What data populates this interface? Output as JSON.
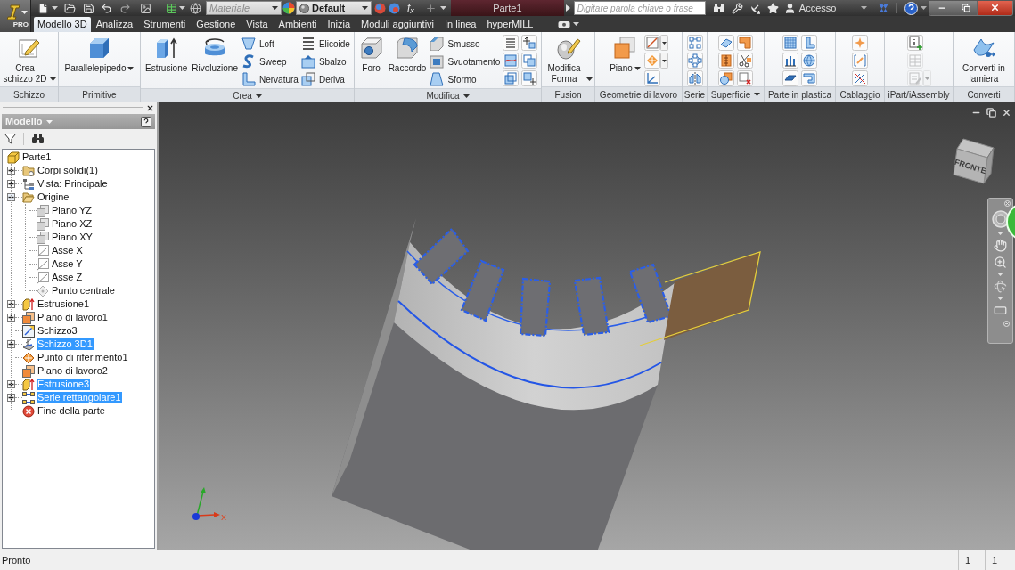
{
  "app_button": {
    "badge": "PRO"
  },
  "title_bar": {
    "material": {
      "value": "Materiale",
      "disabled": true
    },
    "appearance": {
      "value": "Default",
      "disabled": false
    },
    "formula_button": "f$_{x}$",
    "document_title": "Parte1",
    "search": {
      "placeholder": "Digitare parola chiave o frase"
    },
    "sign_in": "Accesso"
  },
  "tabs": [
    {
      "label": "Modello 3D",
      "selected": true
    },
    {
      "label": "Analizza",
      "selected": false
    },
    {
      "label": "Strumenti",
      "selected": false
    },
    {
      "label": "Gestione",
      "selected": false
    },
    {
      "label": "Vista",
      "selected": false
    },
    {
      "label": "Ambienti",
      "selected": false
    },
    {
      "label": "Inizia",
      "selected": false
    },
    {
      "label": "Moduli aggiuntivi",
      "selected": false
    },
    {
      "label": "In linea",
      "selected": false
    },
    {
      "label": "hyperMILL",
      "selected": false
    }
  ],
  "ribbon": [
    {
      "title": "Schizzo",
      "menu": false,
      "tools": [
        {
          "kind": "large",
          "label": "Crea schizzo 2D",
          "dropdown": true,
          "disabled": false
        }
      ]
    },
    {
      "title": "Primitive",
      "menu": false,
      "tools": [
        {
          "kind": "large",
          "label": "Parallelepipedo",
          "dropdown": true,
          "disabled": false
        }
      ]
    },
    {
      "title": "Crea",
      "menu": true,
      "tools": [
        {
          "kind": "large",
          "label": "Estrusione",
          "dropdown": false,
          "disabled": false
        },
        {
          "kind": "large",
          "label": "Rivoluzione",
          "dropdown": false,
          "disabled": false
        },
        {
          "kind": "small",
          "label": "Loft",
          "disabled": false
        },
        {
          "kind": "small",
          "label": "Sweep",
          "disabled": false
        },
        {
          "kind": "small",
          "label": "Nervatura",
          "disabled": false
        },
        {
          "kind": "small",
          "label": "Elicoide",
          "disabled": false
        },
        {
          "kind": "small",
          "label": "Sbalzo",
          "disabled": false
        },
        {
          "kind": "small",
          "label": "Deriva",
          "disabled": false
        }
      ]
    },
    {
      "title": "Modifica",
      "menu": true,
      "tools": [
        {
          "kind": "large",
          "label": "Foro",
          "dropdown": false,
          "disabled": false
        },
        {
          "kind": "large",
          "label": "Raccordo",
          "dropdown": false,
          "disabled": false
        },
        {
          "kind": "small",
          "label": "Smusso",
          "disabled": false
        },
        {
          "kind": "small",
          "label": "Svuotamento",
          "disabled": false
        },
        {
          "kind": "small",
          "label": "Sformo",
          "disabled": false
        },
        {
          "kind": "icon",
          "dropdown": false,
          "disabled": false
        },
        {
          "kind": "icon",
          "dropdown": false,
          "disabled": false
        },
        {
          "kind": "icon",
          "dropdown": false,
          "disabled": false
        },
        {
          "kind": "icon",
          "dropdown": false,
          "disabled": false
        },
        {
          "kind": "icon",
          "dropdown": false,
          "disabled": false
        },
        {
          "kind": "icon",
          "dropdown": false,
          "disabled": false
        }
      ]
    },
    {
      "title": "Fusion",
      "menu": false,
      "tools": [
        {
          "kind": "large",
          "label": "Modifica Forma",
          "dropdown": true,
          "disabled": false
        }
      ]
    },
    {
      "title": "Geometrie di lavoro",
      "menu": false,
      "tools": [
        {
          "kind": "large",
          "label": "Piano",
          "dropdown": true,
          "disabled": false
        },
        {
          "kind": "icon",
          "dropdown": true,
          "disabled": false
        },
        {
          "kind": "icon",
          "dropdown": true,
          "disabled": false
        },
        {
          "kind": "icon",
          "dropdown": false,
          "disabled": false
        }
      ]
    },
    {
      "title": "Serie",
      "menu": false,
      "tools": [
        {
          "kind": "icon",
          "dropdown": false,
          "disabled": false
        },
        {
          "kind": "icon",
          "dropdown": false,
          "disabled": false
        },
        {
          "kind": "icon",
          "dropdown": false,
          "disabled": false
        }
      ]
    },
    {
      "title": "Superficie",
      "menu": true,
      "tools": [
        {
          "kind": "icon",
          "dropdown": false,
          "disabled": false
        },
        {
          "kind": "icon",
          "dropdown": false,
          "disabled": false
        },
        {
          "kind": "icon",
          "dropdown": false,
          "disabled": false
        },
        {
          "kind": "icon",
          "dropdown": false,
          "disabled": false
        },
        {
          "kind": "icon",
          "dropdown": false,
          "disabled": false
        },
        {
          "kind": "icon",
          "dropdown": false,
          "disabled": false
        }
      ]
    },
    {
      "title": "Parte in plastica",
      "menu": false,
      "tools": [
        {
          "kind": "icon",
          "dropdown": false,
          "disabled": false
        },
        {
          "kind": "icon",
          "dropdown": false,
          "disabled": false
        },
        {
          "kind": "icon",
          "dropdown": false,
          "disabled": false
        },
        {
          "kind": "icon",
          "dropdown": false,
          "disabled": false
        },
        {
          "kind": "icon",
          "dropdown": false,
          "disabled": false
        },
        {
          "kind": "icon",
          "dropdown": false,
          "disabled": false
        }
      ]
    },
    {
      "title": "Cablaggio",
      "menu": false,
      "tools": [
        {
          "kind": "icon",
          "dropdown": false,
          "disabled": false
        },
        {
          "kind": "icon",
          "dropdown": false,
          "disabled": false
        },
        {
          "kind": "icon",
          "dropdown": false,
          "disabled": false
        }
      ]
    },
    {
      "title": "iPart/iAssembly",
      "menu": false,
      "tools": [
        {
          "kind": "icon",
          "dropdown": false,
          "disabled": false
        },
        {
          "kind": "icon",
          "dropdown": false,
          "disabled": true
        },
        {
          "kind": "icon",
          "dropdown": true,
          "disabled": true
        }
      ]
    },
    {
      "title": "Converti",
      "menu": false,
      "tools": [
        {
          "kind": "large",
          "label": "Converti in lamiera",
          "dropdown": false,
          "disabled": false
        }
      ]
    }
  ],
  "model_browser": {
    "title": "Modello",
    "tree": [
      {
        "label": "Parte1",
        "kind": "part",
        "selected": false,
        "children": [
          {
            "label": "Corpi solidi(1)",
            "kind": "bodies",
            "selected": false,
            "expanded": false
          },
          {
            "label": "Vista: Principale",
            "kind": "view",
            "selected": false,
            "expanded": false
          },
          {
            "label": "Origine",
            "kind": "folder",
            "selected": false,
            "expanded": true,
            "children": [
              {
                "label": "Piano YZ",
                "kind": "plane",
                "selected": false
              },
              {
                "label": "Piano XZ",
                "kind": "plane",
                "selected": false
              },
              {
                "label": "Piano XY",
                "kind": "plane",
                "selected": false
              },
              {
                "label": "Asse X",
                "kind": "axis",
                "selected": false
              },
              {
                "label": "Asse Y",
                "kind": "axis",
                "selected": false
              },
              {
                "label": "Asse Z",
                "kind": "axis",
                "selected": false
              },
              {
                "label": "Punto centrale",
                "kind": "point",
                "selected": false
              }
            ]
          },
          {
            "label": "Estrusione1",
            "kind": "extrusion",
            "selected": false,
            "expanded": false
          },
          {
            "label": "Piano di lavoro1",
            "kind": "work_plane",
            "selected": false,
            "expanded": false
          },
          {
            "label": "Schizzo3",
            "kind": "sketch",
            "selected": false
          },
          {
            "label": "Schizzo 3D1",
            "kind": "sketch_3d",
            "selected": true,
            "expanded": false
          },
          {
            "label": "Punto di riferimento1",
            "kind": "work_point",
            "selected": false
          },
          {
            "label": "Piano di lavoro2",
            "kind": "work_plane",
            "selected": false
          },
          {
            "label": "Estrusione3",
            "kind": "extrusion",
            "selected": true,
            "expanded": false
          },
          {
            "label": "Serie rettangolare1",
            "kind": "pattern",
            "selected": true,
            "expanded": false
          },
          {
            "label": "Fine della parte",
            "kind": "end",
            "selected": false
          }
        ]
      }
    ]
  },
  "viewport": {
    "view_cube_label": "FRONTE",
    "triad_label": "X"
  },
  "status_bar": {
    "message": "Pronto",
    "fields": [
      "1",
      "1"
    ]
  }
}
